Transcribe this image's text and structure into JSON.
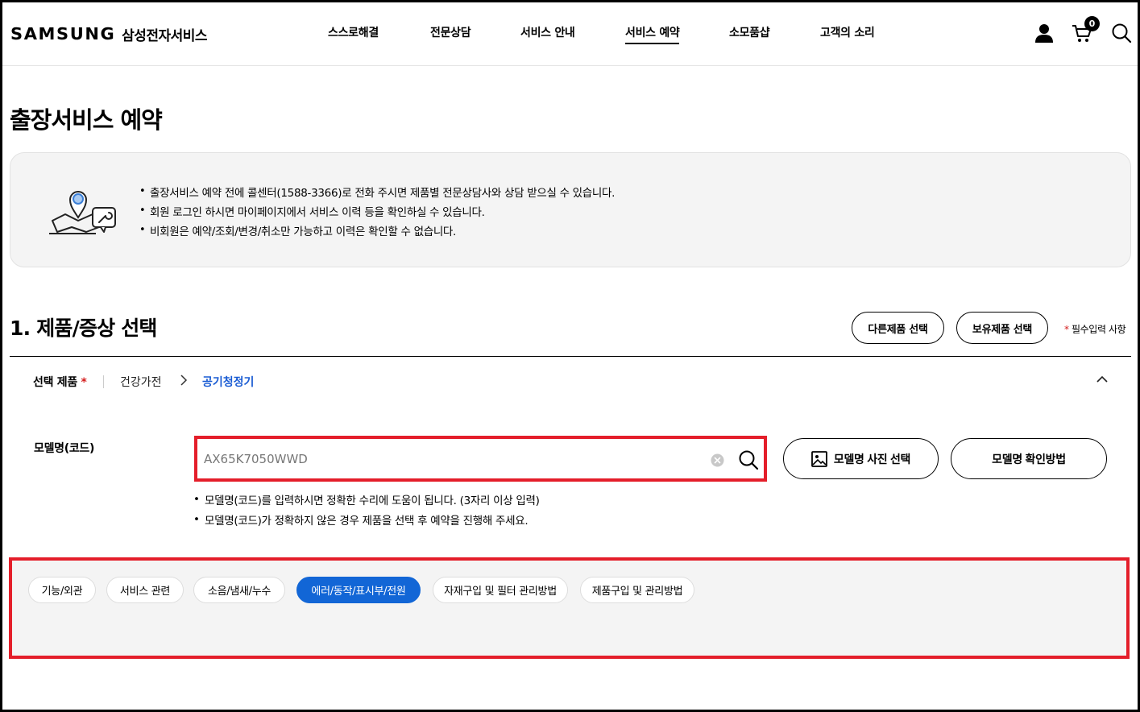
{
  "header": {
    "logo": "SAMSUNG",
    "logo_sub": "삼성전자서비스",
    "nav": [
      "스스로해결",
      "전문상담",
      "서비스 안내",
      "서비스 예약",
      "소모품샵",
      "고객의 소리"
    ],
    "active_nav": "서비스 예약",
    "cart_count": "0",
    "icons": [
      "user-icon",
      "cart-icon",
      "search-icon"
    ]
  },
  "page": {
    "title": "출장서비스 예약"
  },
  "info": {
    "items": [
      "출장서비스 예약 전에 콜센터(1588-3366)로 전화 주시면 제품별 전문상담사와 상담 받으실 수 있습니다.",
      "회원 로그인 하시면 마이페이지에서 서비스 이력 등을 확인하실 수 있습니다.",
      "비회원은 예약/조회/변경/취소만 가능하고 이력은 확인할 수 없습니다."
    ]
  },
  "section1": {
    "title": "1. 제품/증상 선택",
    "other_product_btn": "다른제품 선택",
    "owned_product_btn": "보유제품 선택",
    "required_star": "*",
    "required_note": "필수입력 사항",
    "selected_label": "선택 제품",
    "crumb_category": "건강가전",
    "crumb_product": "공기청정기",
    "model_label": "모델명(코드)",
    "model_value": "AX65K7050WWD",
    "photo_btn": "모델명 사진 선택",
    "howto_btn": "모델명 확인방법",
    "hints": [
      "모델명(코드)를 입력하시면 정확한 수리에 도움이 됩니다. (3자리 이상 입력)",
      "모델명(코드)가 정확하지 않은 경우 제품을 선택 후 예약을 진행해 주세요."
    ]
  },
  "symptoms": {
    "chips": [
      "기능/외관",
      "서비스 관련",
      "소음/냄새/누수",
      "에러/동작/표시부/전원",
      "자재구입 및 필터 관리방법",
      "제품구입 및 관리방법"
    ],
    "active": "에러/동작/표시부/전원"
  },
  "colors": {
    "accent": "#1266d6",
    "highlight": "#e41e2a",
    "required": "#d41b1b",
    "crumb": "#1a5cd3"
  }
}
